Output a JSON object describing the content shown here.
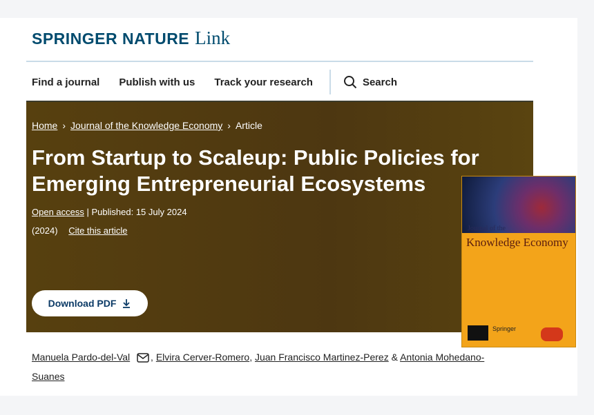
{
  "logo": {
    "brand": "Springer Nature",
    "suffix": "Link"
  },
  "nav": {
    "items": [
      "Find a journal",
      "Publish with us",
      "Track your research"
    ],
    "search_label": "Search"
  },
  "breadcrumb": {
    "home": "Home",
    "journal": "Journal of the Knowledge Economy",
    "current": "Article"
  },
  "article": {
    "title": "From Startup to Scaleup: Public Policies for Emerging Entrepreneurial Ecosystems",
    "open_access": "Open access",
    "published": "Published: 15 July 2024",
    "year": "(2024)",
    "cite": "Cite this article",
    "download": "Download PDF"
  },
  "cover": {
    "journal_small": "Journal of the",
    "journal_big": "Knowledge Economy",
    "publisher": "Springer"
  },
  "authors": [
    "Manuela Pardo-del-Val",
    "Elvira Cerver-Romero",
    "Juan Francisco Martinez-Perez",
    "Antonia Mohedano-Suanes"
  ],
  "authors_sep": {
    "comma": ",",
    "amp": "&"
  },
  "colors": {
    "brand": "#004b6e",
    "hero": "#4d3711",
    "button_text": "#0b3a66",
    "cover": "#f3a41a"
  }
}
